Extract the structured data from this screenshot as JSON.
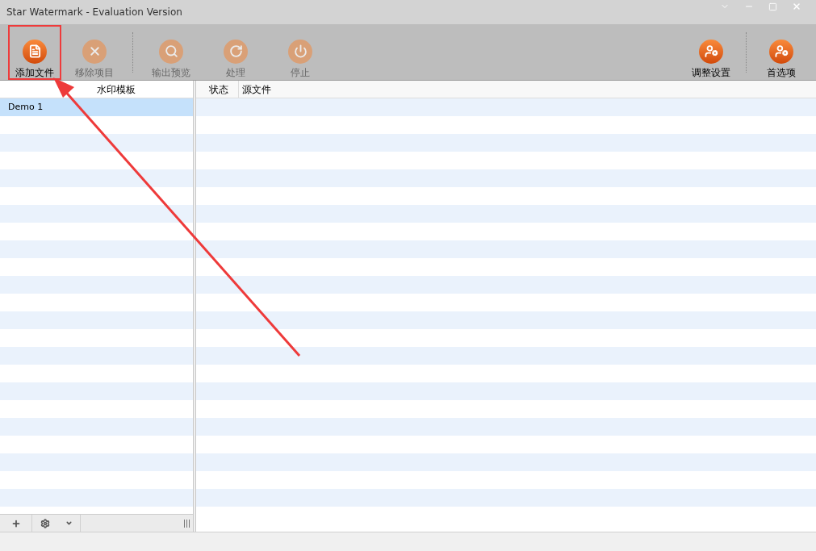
{
  "window": {
    "title": "Star Watermark - Evaluation Version"
  },
  "toolbar": {
    "left": [
      {
        "kind": "add",
        "label": "添加文件",
        "disabled": false,
        "highlighted": true
      },
      {
        "kind": "remove",
        "label": "移除项目",
        "disabled": true,
        "highlighted": false
      },
      {
        "kind": "preview",
        "label": "输出预览",
        "disabled": true,
        "highlighted": false
      },
      {
        "kind": "process",
        "label": "处理",
        "disabled": true,
        "highlighted": false
      },
      {
        "kind": "stop",
        "label": "停止",
        "disabled": true,
        "highlighted": false
      }
    ],
    "right": [
      {
        "kind": "settings",
        "label": "调整设置",
        "disabled": false,
        "highlighted": false
      },
      {
        "kind": "settings",
        "label": "首选项",
        "disabled": false,
        "highlighted": false
      }
    ]
  },
  "templates": {
    "column": "水印模板",
    "items": [
      {
        "label": "Demo 1",
        "selected": true
      }
    ]
  },
  "files": {
    "columns": [
      "状态",
      "源文件"
    ]
  }
}
